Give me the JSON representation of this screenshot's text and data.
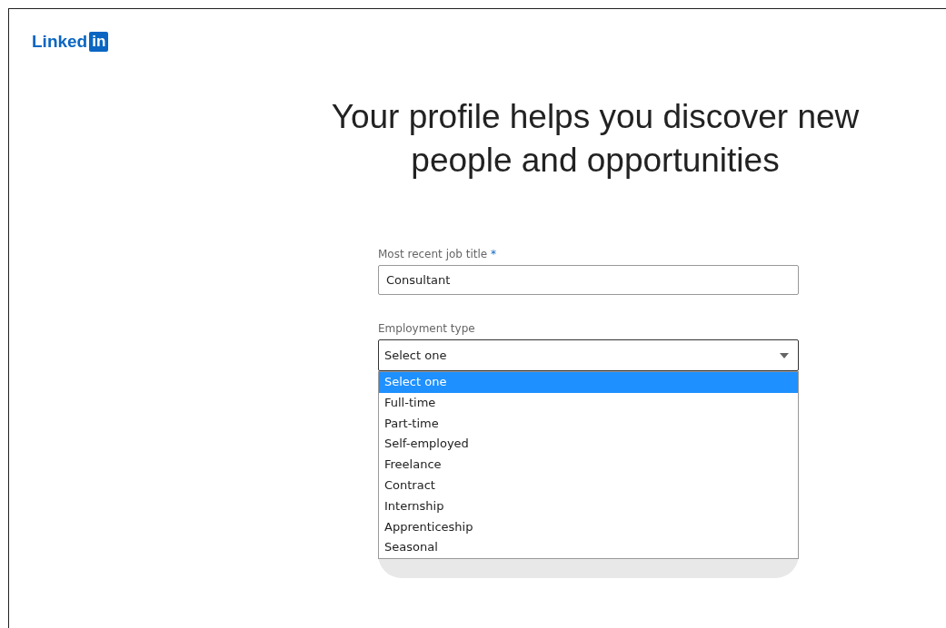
{
  "logo": {
    "wordmark": "Linked",
    "badge": "in"
  },
  "headline": "Your profile helps you discover new people and opportunities",
  "form": {
    "job_title": {
      "label": "Most recent job title",
      "required_mark": "*",
      "value": "Consultant"
    },
    "employment_type": {
      "label": "Employment type",
      "value": "Select one",
      "expanded": true,
      "options": [
        {
          "label": "Select one",
          "selected": true
        },
        {
          "label": "Full-time",
          "selected": false
        },
        {
          "label": "Part-time",
          "selected": false
        },
        {
          "label": "Self-employed",
          "selected": false
        },
        {
          "label": "Freelance",
          "selected": false
        },
        {
          "label": "Contract",
          "selected": false
        },
        {
          "label": "Internship",
          "selected": false
        },
        {
          "label": "Apprenticeship",
          "selected": false
        },
        {
          "label": "Seasonal",
          "selected": false
        }
      ]
    }
  }
}
